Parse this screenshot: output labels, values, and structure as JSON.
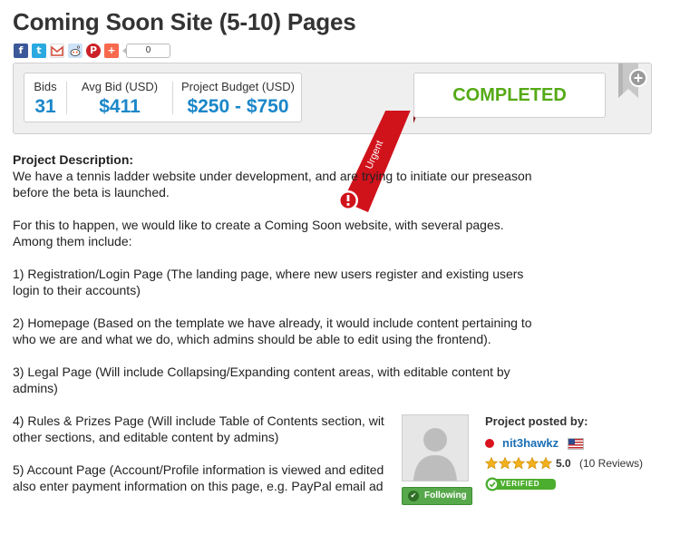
{
  "page": {
    "title": "Coming Soon Site (5-10) Pages"
  },
  "share": {
    "icons": [
      "facebook-icon",
      "twitter-icon",
      "gmail-icon",
      "reddit-icon",
      "pinterest-icon",
      "addthis-icon"
    ],
    "count": "0"
  },
  "stats": {
    "bids_label": "Bids",
    "bids_value": "31",
    "avg_bid_label": "Avg Bid (USD)",
    "avg_bid_value": "$411",
    "budget_label": "Project Budget (USD)",
    "budget_value": "$250 - $750"
  },
  "ribbon": {
    "label": "Urgent",
    "color": "#d0121b"
  },
  "status": {
    "label": "COMPLETED",
    "color": "#55aa15"
  },
  "bookmark": {
    "icon": "bookmark-add-icon"
  },
  "description": {
    "heading": "Project Description:",
    "paragraphs": [
      [
        "We have a tennis ladder website under development, and are trying to initiate our preseason",
        "before the beta is launched."
      ],
      [
        "For this to happen, we would like to create a Coming Soon website, with several pages.",
        "Among them include:"
      ],
      [
        "1) Registration/Login Page (The landing page, where new users register and existing users",
        "login to their accounts)"
      ],
      [
        "2) Homepage (Based on the template we have already, it would include content pertaining to",
        "who we are and what we do, which admins should be able to edit using the frontend)."
      ],
      [
        "3) Legal Page (Will include Collapsing/Expanding content areas, with editable content by",
        "admins)"
      ],
      [
        "4) Rules & Prizes Page (Will include Table of Contents section, wit",
        "other sections, and editable content by admins)"
      ],
      [
        "5) Account Page (Account/Profile information is viewed and edited",
        "also enter payment information on this page, e.g. PayPal email ad"
      ]
    ]
  },
  "poster": {
    "label": "Project posted by:",
    "username": "nit3hawkz",
    "online_color": "#d9141e",
    "country_flag": "us-flag-icon",
    "stars": 5,
    "rating": "5.0",
    "reviews": "(10 Reviews)",
    "follow_label": "Following",
    "verified_label": "VERIFIED",
    "accent_color": "#1a86c9"
  }
}
